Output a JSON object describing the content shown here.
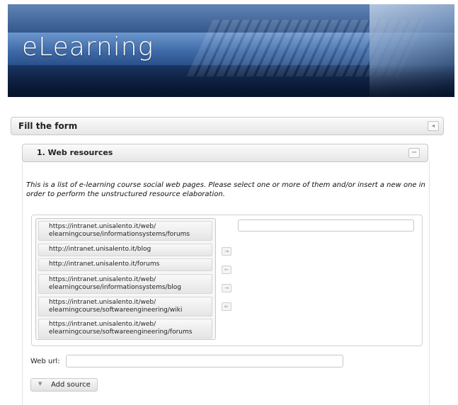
{
  "banner": {
    "logo_text": "eLearning"
  },
  "form": {
    "title": "Fill the form"
  },
  "section": {
    "title": "1. Web resources",
    "description": "This is a list of e-learning course social web pages. Please select one or more of them and/or insert a new one in order to perform the unstructured resource elaboration."
  },
  "resources": [
    {
      "label": "https://intranet.unisalento.it/web/\nelearningcourse/informationsystems/forums"
    },
    {
      "label": "http://intranet.unisalento.it/blog"
    },
    {
      "label": "http://intranet.unisalento.it/forums"
    },
    {
      "label": "https://intranet.unisalento.it/web/\nelearningcourse/informationsystems/blog"
    },
    {
      "label": "https://intranet.unisalento.it/web/\nelearningcourse/softwareengineering/wiki"
    },
    {
      "label": "https://intranet.unisalento.it/web/\nelearningcourse/softwareengineering/forums"
    }
  ],
  "transfer": {
    "move_all_right": "⇥",
    "move_left": "←",
    "move_right": "→",
    "move_all_left": "⇤"
  },
  "web_url": {
    "label": "Web url:",
    "value": ""
  },
  "add_source": {
    "caret": "▼",
    "label": "Add source"
  },
  "icons": {
    "collapse_panel": "◂",
    "minimize_section": "−"
  }
}
